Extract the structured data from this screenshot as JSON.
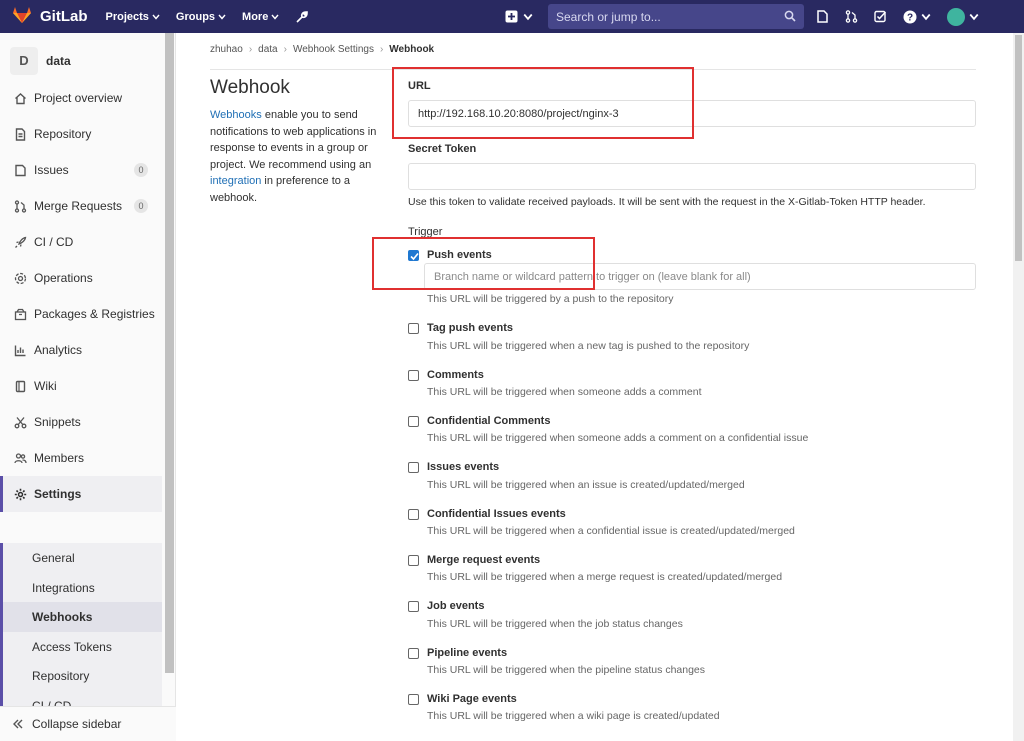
{
  "navbar": {
    "brand": "GitLab",
    "menus": [
      {
        "label": "Projects"
      },
      {
        "label": "Groups"
      },
      {
        "label": "More"
      }
    ],
    "search_placeholder": "Search or jump to..."
  },
  "sidebar": {
    "project_initial": "D",
    "project_name": "data",
    "items": [
      {
        "label": "Project overview",
        "icon": "home-icon"
      },
      {
        "label": "Repository",
        "icon": "doc-icon"
      },
      {
        "label": "Issues",
        "icon": "issues-icon",
        "badge": "0"
      },
      {
        "label": "Merge Requests",
        "icon": "merge-icon",
        "badge": "0"
      },
      {
        "label": "CI / CD",
        "icon": "rocket-icon"
      },
      {
        "label": "Operations",
        "icon": "cloud-icon"
      },
      {
        "label": "Packages & Registries",
        "icon": "package-icon"
      },
      {
        "label": "Analytics",
        "icon": "chart-icon"
      },
      {
        "label": "Wiki",
        "icon": "book-icon"
      },
      {
        "label": "Snippets",
        "icon": "scissors-icon"
      },
      {
        "label": "Members",
        "icon": "users-icon"
      },
      {
        "label": "Settings",
        "icon": "gear-icon"
      }
    ],
    "settings_sub": [
      {
        "label": "General"
      },
      {
        "label": "Integrations"
      },
      {
        "label": "Webhooks"
      },
      {
        "label": "Access Tokens"
      },
      {
        "label": "Repository"
      },
      {
        "label": "CI / CD"
      }
    ],
    "collapse_label": "Collapse sidebar"
  },
  "breadcrumb": [
    "zhuhao",
    "data",
    "Webhook Settings",
    "Webhook"
  ],
  "page": {
    "title": "Webhook",
    "desc_link1": "Webhooks",
    "desc_part1": " enable you to send notifications to web applications in response to events in a group or project. We recommend using an ",
    "desc_link2": "integration",
    "desc_part2": " in preference to a webhook."
  },
  "form": {
    "url_label": "URL",
    "url_value": "http://192.168.10.20:8080/project/nginx-3",
    "token_label": "Secret Token",
    "token_value": "",
    "token_help": "Use this token to validate received payloads. It will be sent with the request in the X-Gitlab-Token HTTP header.",
    "trigger_label": "Trigger",
    "branch_placeholder": "Branch name or wildcard pattern to trigger on (leave blank for all)"
  },
  "events": [
    {
      "label": "Push events",
      "desc": "This URL will be triggered by a push to the repository",
      "checked": true
    },
    {
      "label": "Tag push events",
      "desc": "This URL will be triggered when a new tag is pushed to the repository",
      "checked": false
    },
    {
      "label": "Comments",
      "desc": "This URL will be triggered when someone adds a comment",
      "checked": false
    },
    {
      "label": "Confidential Comments",
      "desc": "This URL will be triggered when someone adds a comment on a confidential issue",
      "checked": false
    },
    {
      "label": "Issues events",
      "desc": "This URL will be triggered when an issue is created/updated/merged",
      "checked": false
    },
    {
      "label": "Confidential Issues events",
      "desc": "This URL will be triggered when a confidential issue is created/updated/merged",
      "checked": false
    },
    {
      "label": "Merge request events",
      "desc": "This URL will be triggered when a merge request is created/updated/merged",
      "checked": false
    },
    {
      "label": "Job events",
      "desc": "This URL will be triggered when the job status changes",
      "checked": false
    },
    {
      "label": "Pipeline events",
      "desc": "This URL will be triggered when the pipeline status changes",
      "checked": false
    },
    {
      "label": "Wiki Page events",
      "desc": "This URL will be triggered when a wiki page is created/updated",
      "checked": false
    }
  ],
  "colors": {
    "navbar": "#292961",
    "accent": "#5b4fa8",
    "link": "#1f6fb5",
    "checkbox": "#1f78d1",
    "highlight": "#e03030"
  }
}
